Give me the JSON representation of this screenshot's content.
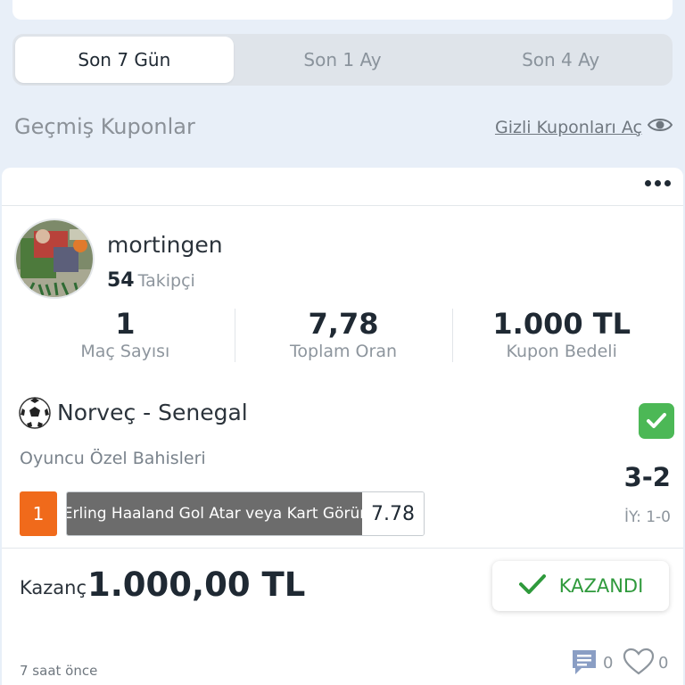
{
  "tabs": [
    {
      "label": "Son 7 Gün",
      "active": true
    },
    {
      "label": "Son 1 Ay",
      "active": false
    },
    {
      "label": "Son 4 Ay",
      "active": false
    }
  ],
  "section": {
    "title": "Geçmiş Kuponlar",
    "hidden_link": "Gizli Kuponları Aç"
  },
  "coupon": {
    "user": {
      "username": "mortingen",
      "followers_count": "54",
      "followers_label": "Takipçi"
    },
    "stats": [
      {
        "value": "1",
        "label": "Maç Sayısı"
      },
      {
        "value": "7,78",
        "label": "Toplam Oran"
      },
      {
        "value": "1.000 TL",
        "label": "Kupon Bedeli"
      }
    ],
    "match": {
      "title": "Norveç - Senegal",
      "market": "Oyuncu Özel Bahisleri",
      "score": "3-2",
      "half_time": "İY: 1-0",
      "pick_number": "1",
      "pick_name": "Erling Haaland Gol Atar veya Kart Görür",
      "pick_odd": "7.78"
    },
    "result": {
      "win_label": "Kazanç",
      "win_amount": "1.000,00 TL",
      "status": "KAZANDI"
    },
    "footer": {
      "time": "7 saat önce",
      "comments": "0",
      "likes": "0"
    }
  },
  "colors": {
    "background": "#e8eff8",
    "pick_number_bg": "#f06a1b",
    "success_green": "#4cb856",
    "status_text": "#2f9a3c"
  }
}
